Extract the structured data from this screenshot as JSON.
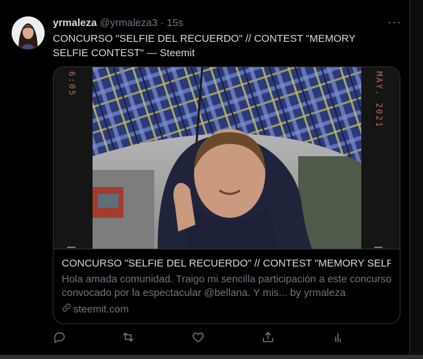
{
  "tweet": {
    "author_name": "yrmaleza",
    "handle": "@yrmaleza3",
    "separator": "·",
    "time": "15s",
    "more_label": "···",
    "text": "CONCURSO \"SELFIE DEL RECUERDO\" // CONTEST \"MEMORY SELFIE CONTEST\" — Steemit"
  },
  "card": {
    "photo_overlay_left": "6:05",
    "photo_overlay_right": "MAY. 2021",
    "title": "CONCURSO \"SELFIE DEL RECUERDO\" // CONTEST \"MEMORY SELFIE C...",
    "description": "Hola amada comunidad. Traigo mi sencilla participación a este concurso convocado por la espectacular @bellana. Y mis... by yrmaleza",
    "domain": "steemit.com"
  },
  "actions": {
    "reply": "reply-icon",
    "retweet": "retweet-icon",
    "like": "heart-icon",
    "share": "share-icon",
    "analytics": "analytics-icon"
  },
  "colors": {
    "background": "#000000",
    "text": "#d9d9d9",
    "muted": "#6e767d",
    "border": "#2f3336",
    "overlay_date": "#b56a55"
  }
}
